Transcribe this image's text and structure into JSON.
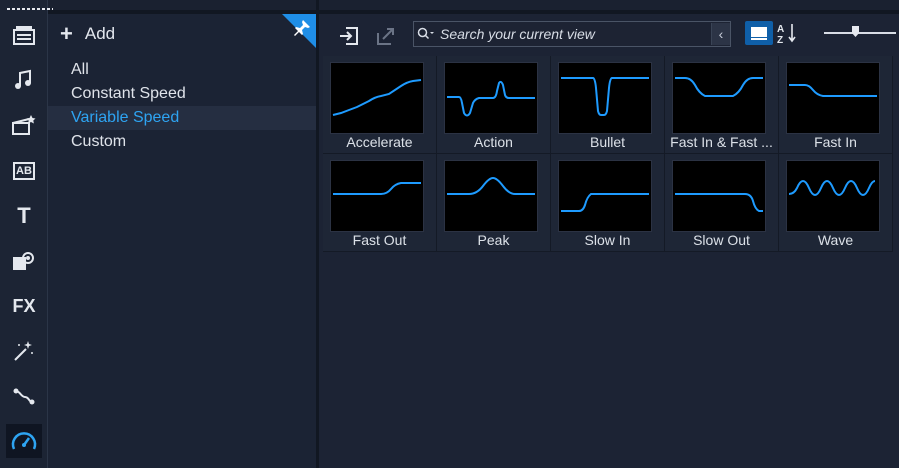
{
  "rail": {
    "items": [
      {
        "name": "media-library-icon"
      },
      {
        "name": "audio-icon"
      },
      {
        "name": "instant-project-icon"
      },
      {
        "name": "title-icon"
      },
      {
        "name": "text-icon"
      },
      {
        "name": "graphics-icon"
      },
      {
        "name": "fx-icon"
      },
      {
        "name": "effects-wand-icon"
      },
      {
        "name": "path-icon"
      },
      {
        "name": "speed-icon"
      }
    ],
    "fx_label": "FX",
    "title_label": "AB",
    "text_label": "T"
  },
  "categories": {
    "add_label": "Add",
    "items": [
      {
        "label": "All"
      },
      {
        "label": "Constant Speed"
      },
      {
        "label": "Variable Speed",
        "selected": true
      },
      {
        "label": "Custom"
      }
    ]
  },
  "search": {
    "placeholder": "Search your current view",
    "value": ""
  },
  "presets": [
    {
      "label": "Accelerate",
      "curve": "accelerate"
    },
    {
      "label": "Action",
      "curve": "action"
    },
    {
      "label": "Bullet",
      "curve": "bullet"
    },
    {
      "label": "Fast In & Fast ...",
      "curve": "fastinout"
    },
    {
      "label": "Fast In",
      "curve": "fastin"
    },
    {
      "label": "Fast Out",
      "curve": "fastout"
    },
    {
      "label": "Peak",
      "curve": "peak"
    },
    {
      "label": "Slow In",
      "curve": "slowin"
    },
    {
      "label": "Slow Out",
      "curve": "slowout"
    },
    {
      "label": "Wave",
      "curve": "wave"
    }
  ],
  "colors": {
    "accent": "#2ea4f2",
    "curve": "#1e9bff",
    "selected_view": "#0f5fa8"
  }
}
